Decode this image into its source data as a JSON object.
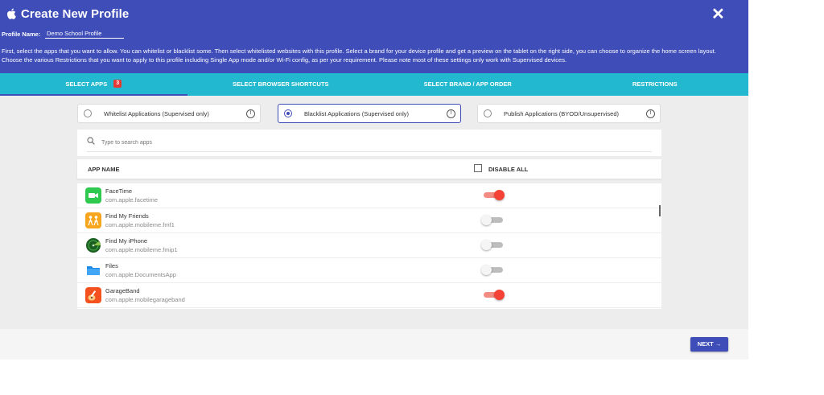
{
  "header": {
    "title": "Create New Profile",
    "profile_name_label": "Profile Name:",
    "profile_name_value": "Demo School Profile",
    "description": "First, select the apps that you want to allow. You can whitelist or blacklist some. Then select whitelisted websites with this profile. Select a brand for your device profile and get a preview on the tablet on the right side, you can choose to organize the home screen layout. Choose the various Restrictions that you want to apply to this profile including Single App mode and/or Wi-Fi config, as per your requirement. Please note most of these settings only work with Supervised devices.",
    "close_symbol": "✕"
  },
  "tabs": [
    {
      "label": "SELECT APPS",
      "badge": "3",
      "active": true
    },
    {
      "label": "SELECT BROWSER SHORTCUTS"
    },
    {
      "label": "SELECT BRAND / APP ORDER"
    },
    {
      "label": "RESTRICTIONS"
    }
  ],
  "modes": [
    {
      "label": "Whitelist Applications (Supervised only)",
      "selected": false
    },
    {
      "label": "Blacklist Applications (Supervised only)",
      "selected": true
    },
    {
      "label": "Publish Applications (BYOD/Unsupervised)",
      "selected": false
    }
  ],
  "search": {
    "placeholder": "Type to search apps"
  },
  "table": {
    "col_name": "APP NAME",
    "col_disable": "DISABLE ALL",
    "rows": [
      {
        "name": "FaceTime",
        "bundle": "com.apple.facetime",
        "icon": "facetime-icon",
        "enabled": true
      },
      {
        "name": "Find My Friends",
        "bundle": "com.apple.mobileme.fmf1",
        "icon": "find-my-friends-icon",
        "enabled": false
      },
      {
        "name": "Find My iPhone",
        "bundle": "com.apple.mobileme.fmip1",
        "icon": "find-my-iphone-icon",
        "enabled": false
      },
      {
        "name": "Files",
        "bundle": "com.apple.DocumentsApp",
        "icon": "files-icon",
        "enabled": false
      },
      {
        "name": "GarageBand",
        "bundle": "com.apple.mobilegarageband",
        "icon": "garageband-icon",
        "enabled": true
      }
    ]
  },
  "footer": {
    "next_label": "NEXT →"
  },
  "colors": {
    "header_bg": "#3f4db8",
    "tab_bg": "#22b8cf",
    "toggle_on": "#f44336",
    "badge": "#e53935"
  }
}
